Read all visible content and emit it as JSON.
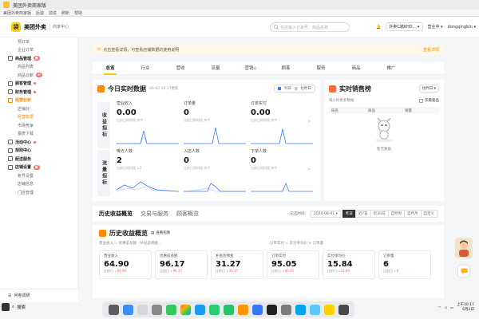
{
  "window": {
    "title": "美团外卖商家版"
  },
  "menubar": [
    "美团外卖商家版",
    "后退",
    "前进",
    "刷新",
    "帮助"
  ],
  "header": {
    "brand": "美团外卖",
    "brand_sub": "商家中心",
    "search_placeholder": "在这输入订单号、商品名称",
    "store": "外卖C端KHD...",
    "status": "营业中",
    "user": "dongqingbin"
  },
  "sidebar": {
    "items": [
      {
        "label": "预订单",
        "type": "sub"
      },
      {
        "label": "企业订单",
        "type": "sub"
      },
      {
        "label": "商品管理",
        "type": "group",
        "badge": "新"
      },
      {
        "label": "商品列表",
        "type": "sub"
      },
      {
        "label": "商品诊断",
        "type": "sub",
        "badge": "新"
      },
      {
        "label": "顾客管理",
        "type": "group",
        "dot": true
      },
      {
        "label": "财务管理",
        "type": "group",
        "dot": true
      },
      {
        "label": "经营分析",
        "type": "group",
        "active": true
      },
      {
        "label": "店铺分",
        "type": "sub"
      },
      {
        "label": "经营数据",
        "type": "sub",
        "active": true
      },
      {
        "label": "市场竞争",
        "type": "sub"
      },
      {
        "label": "报表下载",
        "type": "sub"
      },
      {
        "label": "活动中心",
        "type": "group",
        "dot": true
      },
      {
        "label": "规则中心",
        "type": "group"
      },
      {
        "label": "配送服务",
        "type": "group"
      },
      {
        "label": "店铺设置",
        "type": "group",
        "badge": "新"
      },
      {
        "label": "账号设置",
        "type": "sub"
      },
      {
        "label": "店铺信息",
        "type": "sub"
      },
      {
        "label": "门店管理",
        "type": "sub"
      }
    ],
    "bottom_label": "问卷调研"
  },
  "notice": {
    "text": "点击查看详情，可查看店铺数据的使用说明",
    "link": "查看详情"
  },
  "tabs": [
    {
      "label": "总览",
      "active": true
    },
    {
      "label": "行业"
    },
    {
      "label": "营收"
    },
    {
      "label": "流量"
    },
    {
      "label": "营销",
      "hot": "热"
    },
    {
      "label": "顾客"
    },
    {
      "label": "服务"
    },
    {
      "label": "商品"
    },
    {
      "label": "推广"
    }
  ],
  "realtime": {
    "title": "今日实时数据",
    "updated": "06-02 10:17更新",
    "legend_today": "今日",
    "legend_compare": "比昨日",
    "colors": {
      "today": "#3a7afe",
      "compare": "#b6cff9"
    },
    "group_revenue": "收益指标",
    "group_traffic": "流量指标",
    "metrics_revenue": [
      {
        "label": "营业收入",
        "value": "0.00",
        "cmp": "比前日同时段 持平"
      },
      {
        "label": "订单量",
        "value": "0",
        "cmp": "比前日同时段 持平"
      },
      {
        "label": "订单实付",
        "value": "0.00",
        "cmp": "比前日同时段 持平"
      }
    ],
    "metrics_traffic": [
      {
        "label": "曝光人数",
        "value": "2",
        "cmp": "比前日同时段 ↓2"
      },
      {
        "label": "入店人数",
        "value": "0",
        "cmp": "比前日同时段 持平"
      },
      {
        "label": "下单人数",
        "value": "0",
        "cmp": "比前日同时段 持平"
      }
    ]
  },
  "ranking": {
    "title": "实时销售榜",
    "select": "比昨日",
    "sub": "每小时更新数据",
    "checkbox": "仅看套品",
    "cols": [
      "排名",
      "商品",
      "销量"
    ],
    "empty": "暂无数据"
  },
  "history": {
    "tabs": [
      "历史收益概览",
      "交易与服务",
      "顾客概览"
    ],
    "date_label": "已选时间：",
    "date_value": "2024-06-01",
    "ranges": [
      "昨日",
      "近7日",
      "近30日",
      "自然周",
      "自然月",
      "自定义"
    ],
    "title": "历史收益概览",
    "guide": "查看指南",
    "formula_left": "营业收入 = 优惠前总额 - 补贴及佣金...",
    "formula_right": "订单实付 = 实付单均价 × 订单量",
    "kpis": [
      {
        "label": "营业收入",
        "value": "64.90",
        "cmp": "比前日 ↓",
        "delta": "64.90"
      },
      {
        "label": "优惠前总额",
        "value": "96.17",
        "cmp": "比前日 ↓",
        "delta": "96.17"
      },
      {
        "label": "补贴及佣金",
        "value": "31.27",
        "cmp": "比前日 ↓",
        "delta": "31.27"
      },
      {
        "label": "订单实付",
        "value": "95.05",
        "cmp": "比前日 ↓",
        "delta": "95.05"
      },
      {
        "label": "实付单均价",
        "value": "15.84",
        "cmp": "比前日 ↓",
        "delta": "15.84"
      },
      {
        "label": "订单量",
        "value": "6",
        "cmp": "比前日 ↓",
        "delta": "6"
      }
    ]
  },
  "taskbar": {
    "search": "搜索",
    "time": "上午10:17",
    "date": "6月2日"
  }
}
